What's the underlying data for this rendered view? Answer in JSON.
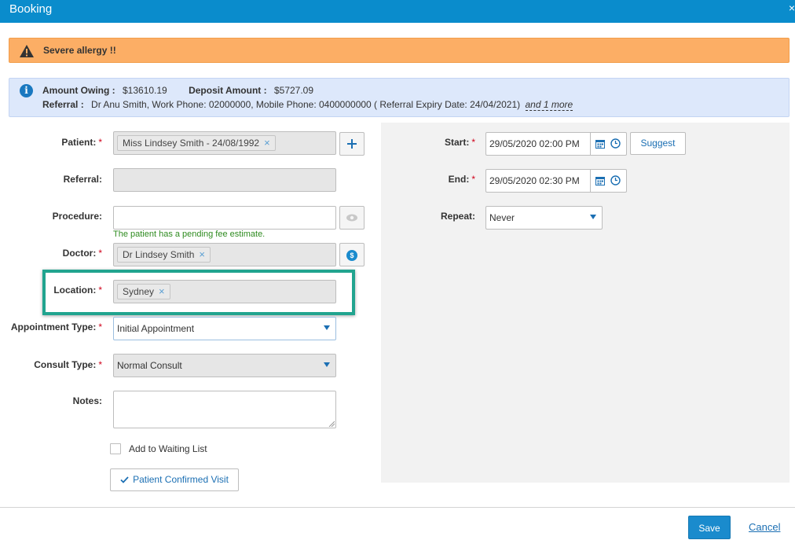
{
  "window": {
    "title": "Booking",
    "close_glyph": "×"
  },
  "alert": {
    "icon": "warning-icon",
    "text": "Severe allergy !!"
  },
  "info": {
    "amount_owing_label": "Amount Owing :",
    "amount_owing_value": "$13610.19",
    "deposit_label": "Deposit Amount :",
    "deposit_value": "$5727.09",
    "referral_label": "Referral :",
    "referral_text": "Dr Anu Smith, Work Phone: 02000000, Mobile Phone: 0400000000 ( Referral Expiry Date: 24/04/2021)",
    "more_link": "and 1 more"
  },
  "form": {
    "patient": {
      "label": "Patient:",
      "chip": "Miss Lindsey Smith - 24/08/1992"
    },
    "referral": {
      "label": "Referral:"
    },
    "procedure": {
      "label": "Procedure:",
      "value": "",
      "hint": "The patient has a pending fee estimate."
    },
    "doctor": {
      "label": "Doctor:",
      "chip": "Dr Lindsey Smith"
    },
    "location": {
      "label": "Location:",
      "chip": "Sydney"
    },
    "appointment_type": {
      "label": "Appointment Type:",
      "value": "Initial Appointment"
    },
    "consult_type": {
      "label": "Consult Type:",
      "value": "Normal Consult"
    },
    "notes": {
      "label": "Notes:",
      "value": ""
    },
    "waiting_list_label": "Add to Waiting List",
    "confirm_button": "Patient Confirmed Visit",
    "required_mark": "*"
  },
  "schedule": {
    "start": {
      "label": "Start:",
      "value": "29/05/2020 02:00 PM"
    },
    "end": {
      "label": "End:",
      "value": "29/05/2020 02:30 PM"
    },
    "repeat": {
      "label": "Repeat:",
      "value": "Never"
    },
    "suggest_button": "Suggest"
  },
  "footer": {
    "save": "Save",
    "cancel": "Cancel"
  },
  "colors": {
    "titlebar": "#0a8ccc",
    "alert": "#fcae65",
    "info": "#dde8fb",
    "primary": "#1a8bcd",
    "highlight": "#21a48f"
  }
}
